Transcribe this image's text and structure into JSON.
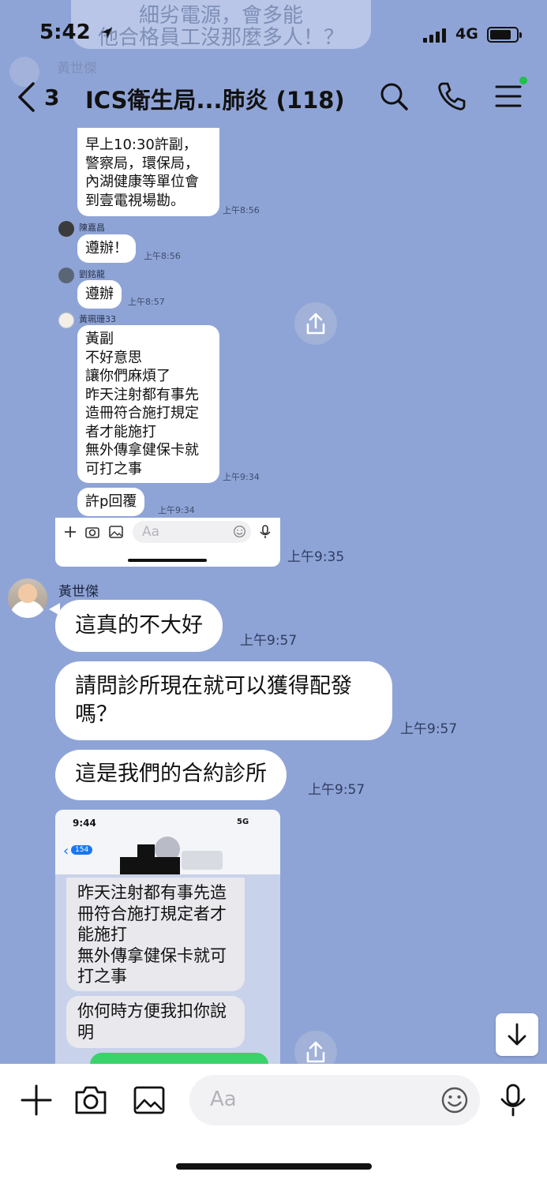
{
  "status_bar": {
    "time": "5:42",
    "network": "4G",
    "background_message_lines": [
      "細劣電源，會多能",
      "他合格員工沒那麼多人！？"
    ]
  },
  "header": {
    "back_count": "3",
    "title": "ICS衛生局...肺炎 (118)",
    "background_sender": "黃世傑",
    "icons": [
      "search-icon",
      "phone-icon",
      "menu-icon"
    ],
    "online_color": "#1ec24a"
  },
  "embedded_chat_1": {
    "first_bubble_lines": [
      "早上10:30許副，",
      "警察局，環保局，",
      "內湖健康等單位會",
      "到壹電視場勘。"
    ],
    "first_time": "上午8:56",
    "msg2": {
      "sender": "陳嘉昌",
      "text": "遵辦！",
      "time": "上午8:56"
    },
    "msg3": {
      "sender": "劉銘龍",
      "text": "遵辦",
      "time": "上午8:57"
    },
    "msg4": {
      "sender": "黃珮珊33",
      "lines": [
        "黃副",
        "不好意思",
        "讓你們麻煩了",
        "昨天注射都有事先",
        "造冊符合施打規定",
        "者才能施打",
        "無外傳拿健保卡就",
        "可打之事"
      ],
      "time": "上午9:34"
    },
    "msg5": {
      "text": "許p回覆",
      "time": "上午9:34"
    },
    "input_placeholder": "Aa"
  },
  "messages": [
    {
      "sender": "黃世傑",
      "text": "這真的不大好",
      "time": "上午9:57"
    },
    {
      "lines": [
        "請問診所現在就可以獲得配發",
        "嗎？"
      ],
      "time": "上午9:57"
    },
    {
      "text": "這是我們的合約診所",
      "time": "上午9:57"
    }
  ],
  "embedded_image_time": "上午9:35",
  "embedded_chat_2": {
    "time": "9:44",
    "network": "5G",
    "back_badge": "154",
    "bubble1_lines": [
      "昨天注射都有事先造",
      "冊符合施打規定者才",
      "能施打",
      "無外傳拿健保卡就可",
      "打之事"
    ],
    "bubble2_lines": [
      "你何時方便我扣你說",
      "明"
    ]
  },
  "input_bar": {
    "placeholder": "Aa",
    "icons": [
      "plus-icon",
      "camera-icon",
      "image-icon",
      "emoji-icon",
      "microphone-icon"
    ]
  },
  "colors": {
    "chat_background": "#8fa4d6",
    "bubble": "#ffffff",
    "share_button": "#a1b1d7",
    "sent_bubble": "#3ad26a"
  }
}
